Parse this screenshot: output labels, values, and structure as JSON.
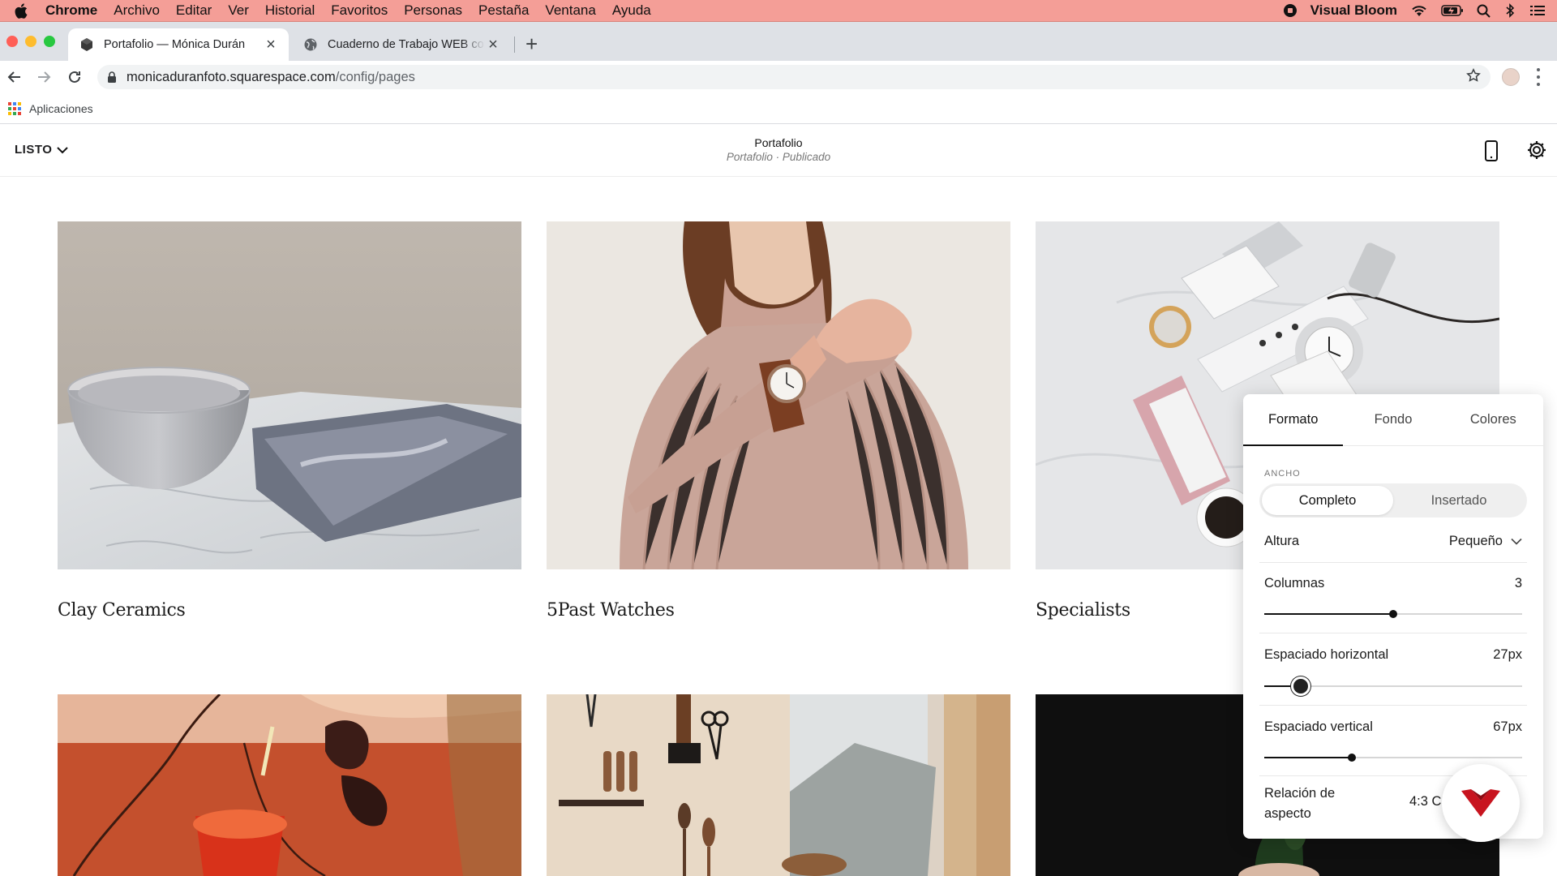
{
  "menubar": {
    "app": "Chrome",
    "items": [
      "Archivo",
      "Editar",
      "Ver",
      "Historial",
      "Favoritos",
      "Personas",
      "Pestaña",
      "Ventana",
      "Ayuda"
    ],
    "status_app": "Visual Bloom",
    "icons": [
      "apple-icon",
      "record-icon",
      "wifi-icon",
      "battery-icon",
      "spotlight-search-icon",
      "bluetooth-icon",
      "control-center-icon"
    ]
  },
  "tabs": [
    {
      "title": "Portafolio — Mónica Durán",
      "favicon": "squarespace-icon",
      "active": true
    },
    {
      "title": "Cuaderno de Trabajo WEB con Squarespace",
      "favicon": "globe-icon",
      "active": false
    }
  ],
  "address": {
    "host": "monicaduranfoto.squarespace.com",
    "path": "/config/pages"
  },
  "bookmarks": {
    "apps_label": "Aplicaciones"
  },
  "editor_header": {
    "done_label": "LISTO",
    "page_title": "Portafolio",
    "page_status": "Portafolio · Publicado"
  },
  "gallery": {
    "items": [
      {
        "caption": "Clay Ceramics"
      },
      {
        "caption": "5Past Watches"
      },
      {
        "caption": "Specialists"
      },
      {
        "caption": ""
      },
      {
        "caption": ""
      },
      {
        "caption": ""
      }
    ]
  },
  "panel": {
    "tabs": [
      "Formato",
      "Fondo",
      "Colores"
    ],
    "active_tab": "Formato",
    "width_label": "ANCHO",
    "width_options": [
      "Completo",
      "Insertado"
    ],
    "width_selected": "Completo",
    "height_label": "Altura",
    "height_value": "Pequeño",
    "columns_label": "Columnas",
    "columns_value": "3",
    "columns_fraction": 0.5,
    "hspacing_label": "Espaciado horizontal",
    "hspacing_value": "27px",
    "hspacing_fraction": 0.14,
    "vspacing_label": "Espaciado vertical",
    "vspacing_value": "67px",
    "vspacing_fraction": 0.34,
    "aspect_label": "Relación de aspecto",
    "aspect_value": "4:3 C"
  },
  "colors": {
    "menubar": "#f49e97",
    "brand_badge": "#c8141f"
  }
}
